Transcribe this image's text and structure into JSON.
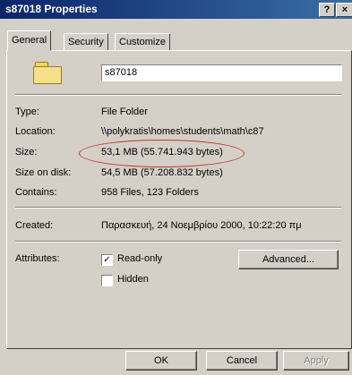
{
  "window": {
    "title": "s87018 Properties",
    "help_label": "?",
    "close_label": "×"
  },
  "tabs": [
    {
      "label": "General",
      "active": true
    },
    {
      "label": "Security",
      "active": false
    },
    {
      "label": "Customize",
      "active": false
    }
  ],
  "general": {
    "folder_name": "s87018",
    "type_label": "Type:",
    "type_value": "File Folder",
    "location_label": "Location:",
    "location_value": "\\\\polykratis\\homes\\students\\math\\c87",
    "size_label": "Size:",
    "size_value": "53,1 MB (55.741.943 bytes)",
    "size_on_disk_label": "Size on disk:",
    "size_on_disk_value": "54,5 MB (57.208.832 bytes)",
    "contains_label": "Contains:",
    "contains_value": "958 Files, 123 Folders",
    "created_label": "Created:",
    "created_value": "Παρασκευή, 24 Νοεμβρίου 2000, 10:22:20 πμ",
    "attributes_label": "Attributes:",
    "readonly_label": "Read-only",
    "readonly_checked": true,
    "hidden_label": "Hidden",
    "hidden_checked": false,
    "advanced_button": "Advanced..."
  },
  "buttons": {
    "ok": "OK",
    "cancel": "Cancel",
    "apply": "Apply"
  },
  "icons": {
    "folder": "folder-icon"
  }
}
